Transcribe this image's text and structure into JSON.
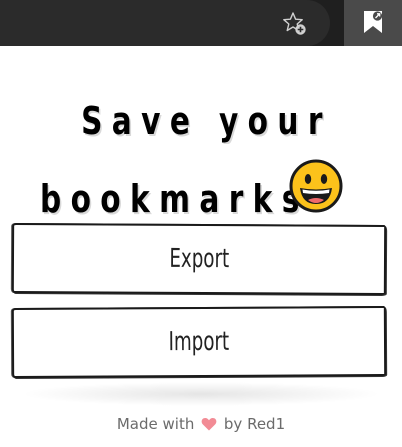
{
  "browser": {
    "favorites_icon": "star-add-icon",
    "extension_icon": "bookmark-export-icon"
  },
  "popup": {
    "headline_line1": "Save your",
    "headline_line2": "bookmarks",
    "emoji": "grinning-face-emoji",
    "export_label": "Export",
    "import_label": "Import",
    "footer_prefix": "Made with",
    "footer_suffix": "by Red1",
    "heart_color": "#f28b95"
  }
}
